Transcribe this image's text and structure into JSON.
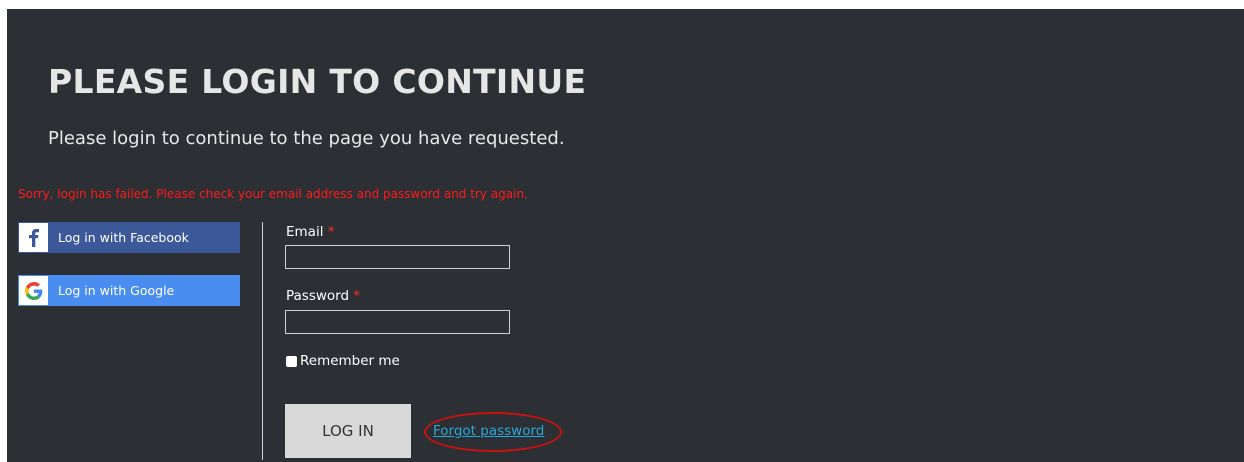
{
  "header": {
    "title": "PLEASE LOGIN TO CONTINUE",
    "subtitle": "Please login to continue to the page you have requested."
  },
  "error_message": "Sorry, login has failed. Please check your email address and password and try again.",
  "social": {
    "facebook_label": "Log in with Facebook",
    "facebook_icon": "facebook-f-icon",
    "google_label": "Log in with Google",
    "google_icon": "google-g-icon"
  },
  "form": {
    "email_label": "Email",
    "email_value": "",
    "password_label": "Password",
    "password_value": "",
    "required_marker": "*",
    "remember_label": "Remember me",
    "remember_checked": false,
    "login_label": "LOG IN",
    "forgot_label": "Forgot password"
  },
  "colors": {
    "background": "#2c2f33",
    "error": "#ff1a1a",
    "facebook": "#3b5998",
    "google": "#4a8df0",
    "link": "#29a8d8",
    "highlight": "#cc1111"
  }
}
